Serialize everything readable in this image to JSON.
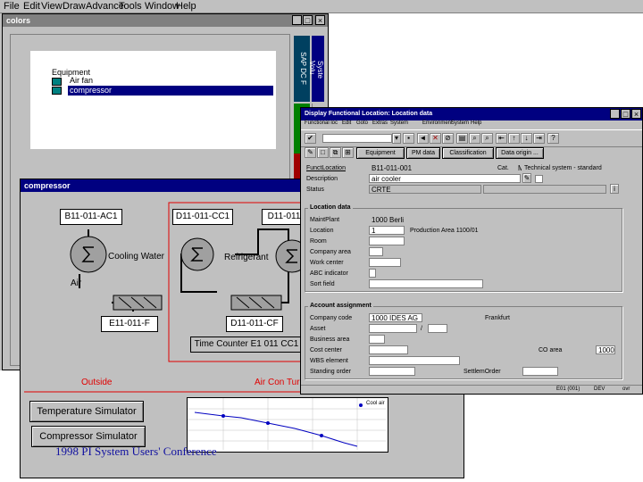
{
  "menubar": {
    "items": [
      "File",
      "Edit",
      "View",
      "Draw",
      "Advance",
      "Tools",
      "Window",
      "Help"
    ]
  },
  "colors_window": {
    "title": "colors",
    "tree_root": "Equipment",
    "tree_items": [
      "Air fan",
      "compressor"
    ],
    "side_tabs": [
      "Syste Volu",
      "SAP DC F"
    ]
  },
  "compressor_window": {
    "title": "compressor",
    "tags": {
      "air_cooler": "B11-011-AC1",
      "refrig_top": "D11-011-CC1",
      "right_top": "D11-011",
      "air_fan": "E11-011-F",
      "chiller": "D11-011-CF",
      "time_counter": "Time Counter E1 011 CC1"
    },
    "labels": {
      "cooling_water": "Cooling Water",
      "air": "Air",
      "refrigerant": "Refrigerant",
      "outside": "Outside",
      "air_control": "Air Con Tur"
    },
    "buttons": {
      "temperature": "Temperature Simulator",
      "compressor": "Compressor Simulator"
    }
  },
  "sap_window": {
    "title": "Display Functional Location: Location data",
    "menu": [
      "Functional loc",
      "Edit",
      "Goto",
      "Extras",
      "System",
      "Environment",
      "System",
      "Help"
    ],
    "tab_buttons": [
      "Equipment",
      "PM data",
      "Classification",
      "Data origin ..."
    ],
    "header": {
      "funct_location_label": "FunctLocation",
      "funct_location_value": "B11-011-001",
      "cat_label": "Cat.",
      "cat_value": "M",
      "cat_desc": "Technical system - standard",
      "description_label": "Description",
      "description_value": "air cooler",
      "status_label": "Status",
      "status_value": "CRTE"
    },
    "location_data": {
      "group_title": "Location data",
      "maint_plant_label": "MaintPlant",
      "maint_plant_value": "1000 Berlin",
      "location_label": "Location",
      "location_value": "1",
      "location_desc": "Production Area 1100/01",
      "room_label": "Room",
      "company_area_label": "Company area",
      "work_center_label": "Work center",
      "abc_label": "ABC indicator",
      "sort_field_label": "Sort field"
    },
    "account_assignment": {
      "group_title": "Account assignment",
      "company_code_label": "Company code",
      "company_code_value": "1000 IDES AG",
      "city": "Frankfurt",
      "asset_label": "Asset",
      "business_area_label": "Business area",
      "cost_center_label": "Cost center",
      "co_area_label": "CO area",
      "co_area_value": "1000",
      "wbs_label": "WBS element",
      "standing_order_label": "Standing order",
      "settlement_order_label": "SettlemOrder"
    },
    "status_bar": [
      "E01 (001)",
      "DEV",
      "ovr"
    ]
  },
  "trend": {
    "legend_label": "Cool air"
  },
  "footer": {
    "conference_text": "1998 PI System Users' Conference"
  },
  "colors_theme": {
    "title_active": "#000080",
    "window_bg": "#c0c0c0",
    "diagram_red": "#e00000",
    "trend_line": "#0000c0"
  }
}
